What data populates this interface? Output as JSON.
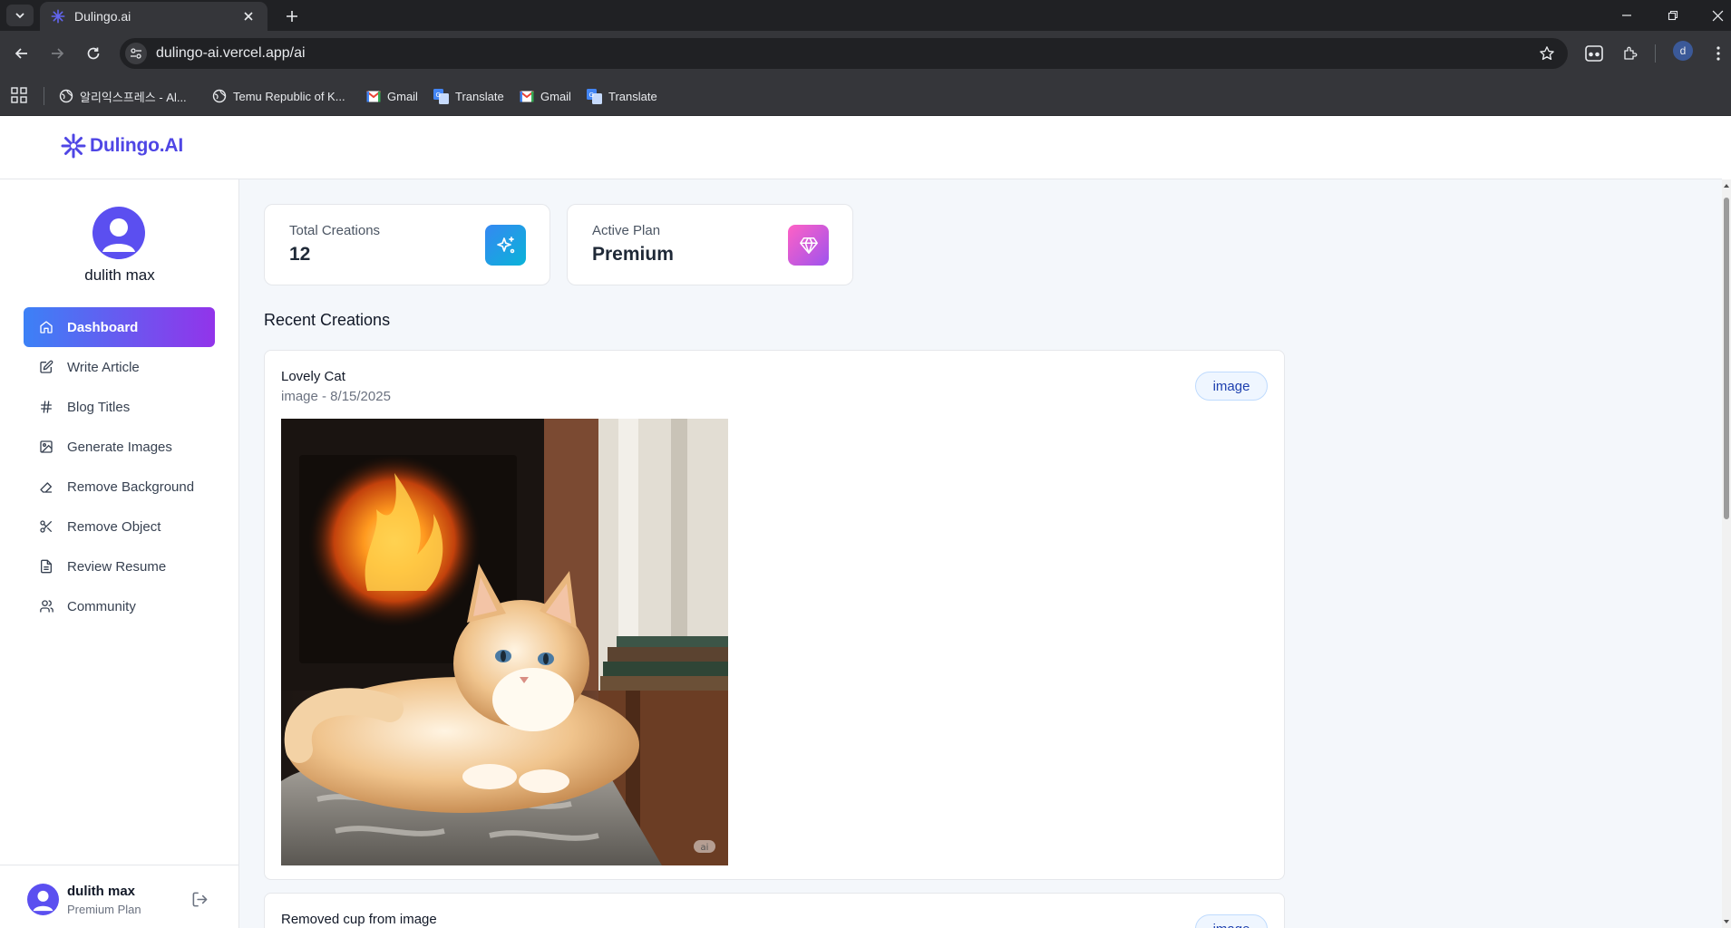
{
  "browser": {
    "tab_title": "Dulingo.ai",
    "url": "dulingo-ai.vercel.app/ai",
    "profile_initial": "d",
    "bookmarks": [
      {
        "label": "알리익스프레스 - Al...",
        "icon": "globe-icon"
      },
      {
        "label": "Temu Republic of K...",
        "icon": "globe-icon"
      },
      {
        "label": "Gmail",
        "icon": "gmail-icon"
      },
      {
        "label": "Translate",
        "icon": "translate-icon"
      },
      {
        "label": "Gmail",
        "icon": "gmail-icon"
      },
      {
        "label": "Translate",
        "icon": "translate-icon"
      }
    ]
  },
  "app": {
    "brand": "Dulingo.AI",
    "accent_color": "#4f46e5",
    "gradient": [
      "#3c81f6",
      "#9234ea"
    ]
  },
  "sidebar": {
    "user_name": "dulith max",
    "nav": [
      {
        "label": "Dashboard",
        "icon": "home-icon",
        "active": true
      },
      {
        "label": "Write Article",
        "icon": "edit-icon",
        "active": false
      },
      {
        "label": "Blog Titles",
        "icon": "hash-icon",
        "active": false
      },
      {
        "label": "Generate Images",
        "icon": "image-icon",
        "active": false
      },
      {
        "label": "Remove Background",
        "icon": "eraser-icon",
        "active": false
      },
      {
        "label": "Remove Object",
        "icon": "scissors-icon",
        "active": false
      },
      {
        "label": "Review Resume",
        "icon": "file-text-icon",
        "active": false
      },
      {
        "label": "Community",
        "icon": "users-icon",
        "active": false
      }
    ],
    "footer": {
      "name": "dulith max",
      "plan": "Premium Plan"
    }
  },
  "stats": {
    "total_creations": {
      "label": "Total Creations",
      "value": "12",
      "icon": "sparkles-icon",
      "color": "#3b82f6"
    },
    "active_plan": {
      "label": "Active Plan",
      "value": "Premium",
      "icon": "gem-icon",
      "color": "#d946ef"
    }
  },
  "recent": {
    "title": "Recent Creations",
    "items": [
      {
        "title": "Lovely Cat",
        "meta": "image - 8/15/2025",
        "badge": "image",
        "image_alt": "cat-by-fireplace-image",
        "image_watermark": "ai"
      },
      {
        "title": "Removed cup from image",
        "meta": "",
        "badge": "image"
      }
    ]
  }
}
